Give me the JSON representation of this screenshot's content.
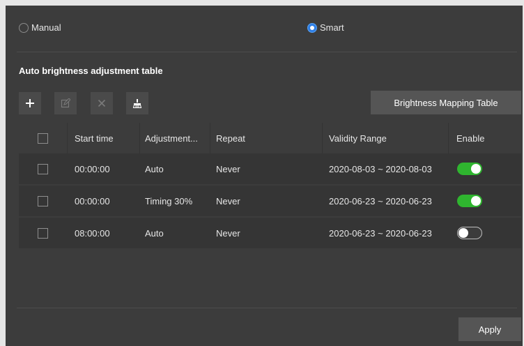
{
  "mode": {
    "manual_label": "Manual",
    "smart_label": "Smart",
    "selected": "Smart"
  },
  "section_title": "Auto brightness adjustment table",
  "toolbar": {
    "add_icon": "plus-icon",
    "edit_icon": "edit-icon",
    "delete_icon": "close-icon",
    "clear_icon": "broom-icon",
    "mapping_button_label": "Brightness Mapping Table"
  },
  "table": {
    "headers": {
      "start_time": "Start time",
      "adjustment": "Adjustment...",
      "repeat": "Repeat",
      "validity_range": "Validity Range",
      "enable": "Enable"
    },
    "rows": [
      {
        "start_time": "00:00:00",
        "adjustment": "Auto",
        "repeat": "Never",
        "validity_range": "2020-08-03 ~ 2020-08-03",
        "enabled": true
      },
      {
        "start_time": "00:00:00",
        "adjustment": "Timing 30%",
        "repeat": "Never",
        "validity_range": "2020-06-23 ~ 2020-06-23",
        "enabled": true
      },
      {
        "start_time": "08:00:00",
        "adjustment": "Auto",
        "repeat": "Never",
        "validity_range": "2020-06-23 ~ 2020-06-23",
        "enabled": false
      }
    ]
  },
  "apply_label": "Apply",
  "colors": {
    "panel_bg": "#3c3c3c",
    "row_bg": "#353535",
    "toggle_on": "#2fb52f",
    "radio_selected": "#2f7fe6"
  }
}
